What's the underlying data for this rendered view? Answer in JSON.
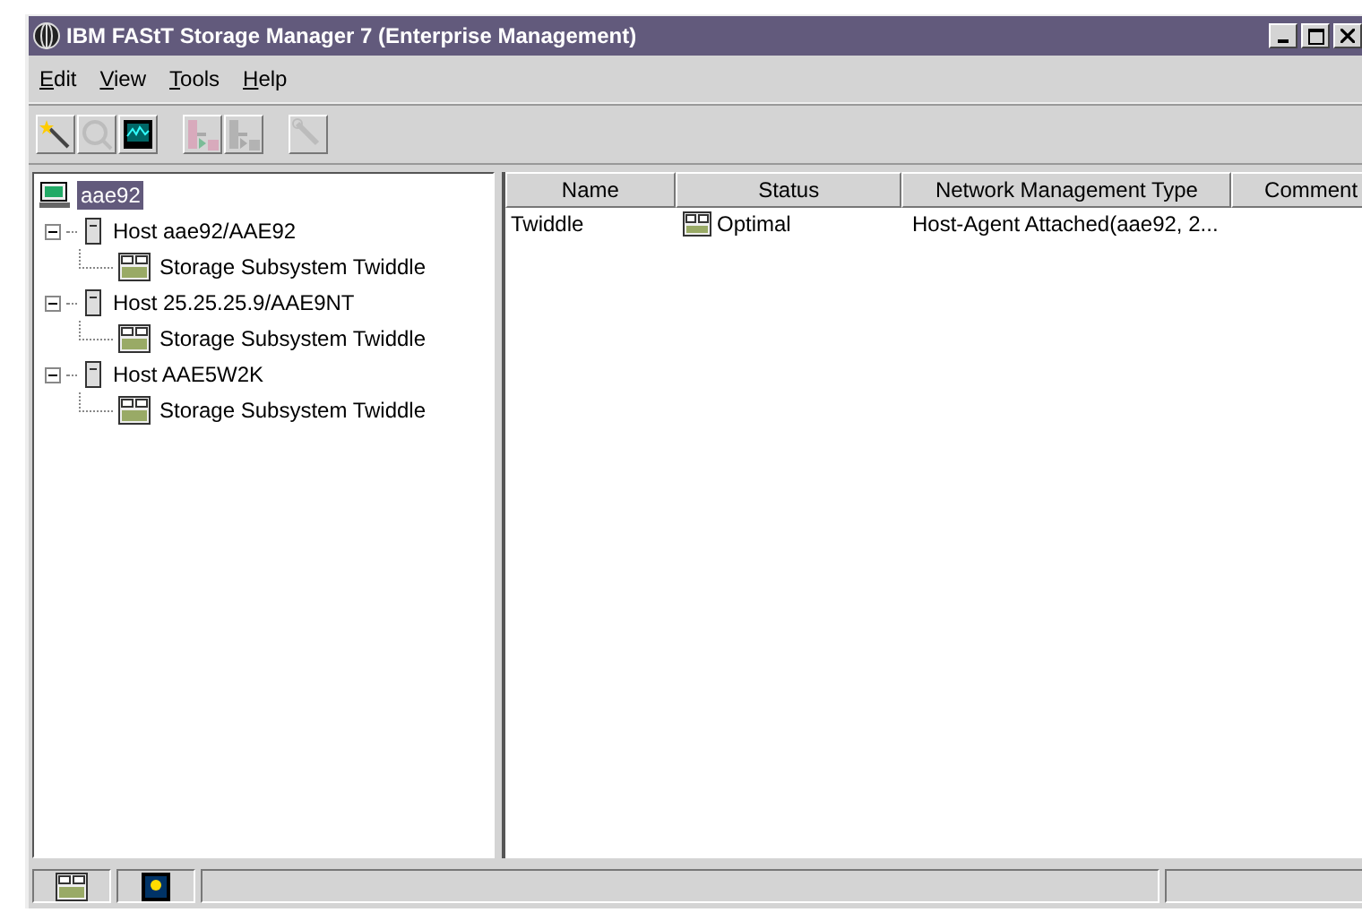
{
  "window": {
    "title": "IBM FAStT Storage Manager 7 (Enterprise Management)"
  },
  "menu": [
    "Edit",
    "View",
    "Tools",
    "Help"
  ],
  "toolbar": [
    {
      "kind": "wand",
      "disabled": false
    },
    {
      "kind": "magnifier",
      "disabled": true
    },
    {
      "kind": "monitor",
      "disabled": false
    },
    {
      "kind": "sep"
    },
    {
      "kind": "add",
      "disabled": true
    },
    {
      "kind": "remove",
      "disabled": true
    },
    {
      "kind": "sep"
    },
    {
      "kind": "wrench",
      "disabled": true
    }
  ],
  "tree": {
    "label": "aae92",
    "selected": true,
    "children": [
      {
        "label": "Host aae92/AAE92",
        "selected": false,
        "expanded": true,
        "children": [
          {
            "label": "Storage Subsystem Twiddle",
            "selected": false
          }
        ]
      },
      {
        "label": "Host 25.25.25.9/AAE9NT",
        "selected": false,
        "expanded": true,
        "children": [
          {
            "label": "Storage Subsystem Twiddle",
            "selected": false
          }
        ]
      },
      {
        "label": "Host AAE5W2K",
        "selected": false,
        "expanded": true,
        "children": [
          {
            "label": "Storage Subsystem Twiddle",
            "selected": false
          }
        ]
      }
    ]
  },
  "table": {
    "columns": [
      "Name",
      "Status",
      "Network Management Type",
      "Comment"
    ],
    "rows": [
      {
        "name": "Twiddle",
        "status": "Optimal",
        "network_management_type": "Host-Agent Attached(aae92, 2..."
      }
    ]
  },
  "status_bar": [
    {
      "kind": "storage"
    },
    {
      "kind": "monitor"
    }
  ]
}
